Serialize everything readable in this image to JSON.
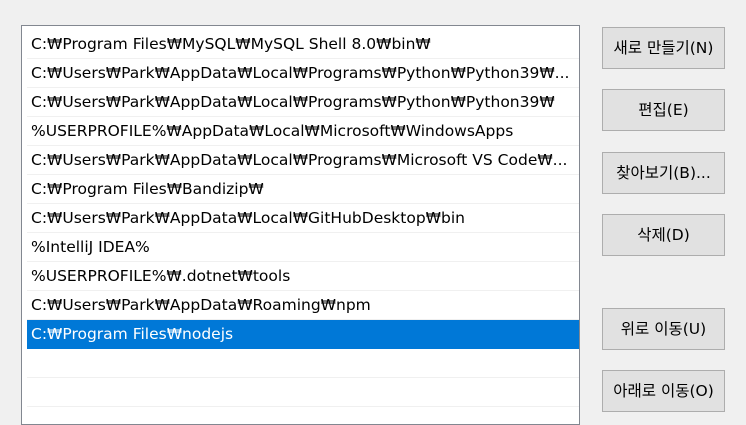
{
  "list": {
    "rows": [
      "C:₩Program Files₩MySQL₩MySQL Shell 8.0₩bin₩",
      "C:₩Users₩Park₩AppData₩Local₩Programs₩Python₩Python39₩...",
      "C:₩Users₩Park₩AppData₩Local₩Programs₩Python₩Python39₩",
      "%USERPROFILE%₩AppData₩Local₩Microsoft₩WindowsApps",
      "C:₩Users₩Park₩AppData₩Local₩Programs₩Microsoft VS Code₩...",
      "C:₩Program Files₩Bandizip₩",
      "C:₩Users₩Park₩AppData₩Local₩GitHubDesktop₩bin",
      "%IntelliJ IDEA%",
      "%USERPROFILE%₩.dotnet₩tools",
      "C:₩Users₩Park₩AppData₩Roaming₩npm",
      "C:₩Program Files₩nodejs"
    ],
    "selected_index": 10
  },
  "buttons": {
    "new": "새로 만들기(N)",
    "edit": "편집(E)",
    "browse": "찾아보기(B)...",
    "delete": "삭제(D)",
    "move_up": "위로 이동(U)",
    "move_down": "아래로 이동(O)"
  },
  "colors": {
    "selection": "#0078d7",
    "button_face": "#e1e1e1"
  }
}
